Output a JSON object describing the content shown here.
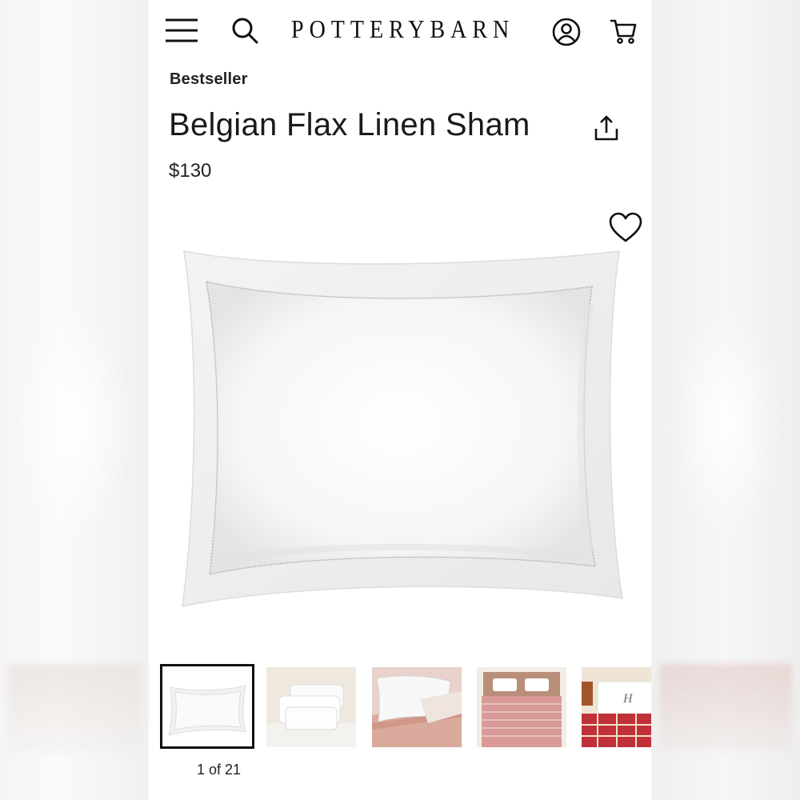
{
  "header": {
    "logo_text": "POTTERYBARN",
    "icons": [
      "menu-icon",
      "search-icon",
      "account-icon",
      "cart-icon"
    ]
  },
  "product": {
    "badge": "Bestseller",
    "title": "Belgian Flax Linen Sham",
    "price": "$130"
  },
  "actions": {
    "share_icon": "share-icon",
    "favorite_icon": "heart-icon"
  },
  "gallery": {
    "counter": "1 of 21",
    "selected_index": 0
  },
  "colors": {
    "text": "#1a1a1a",
    "background": "#ffffff",
    "selected_border": "#111111"
  }
}
